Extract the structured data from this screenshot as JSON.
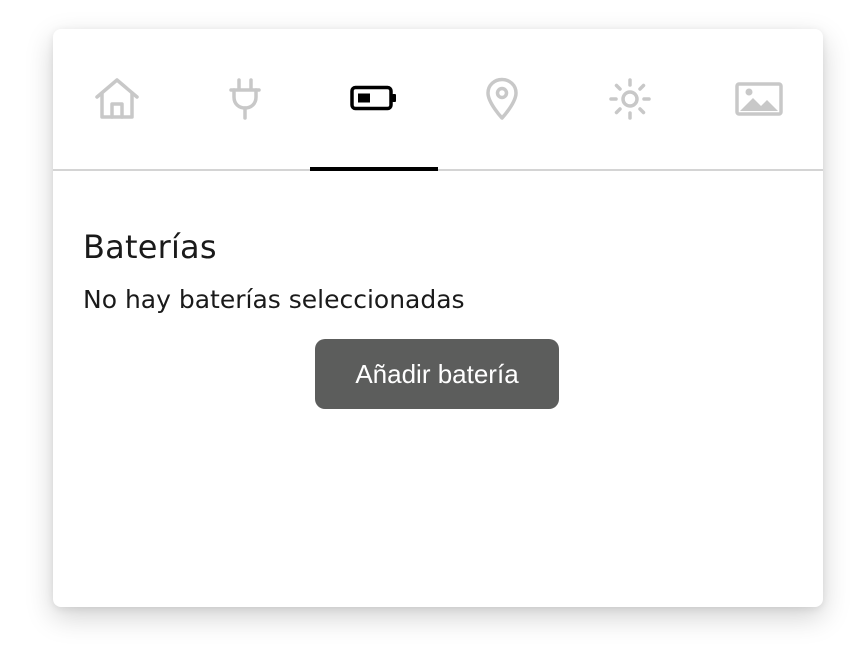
{
  "tabs": [
    {
      "icon": "home-icon",
      "active": false
    },
    {
      "icon": "plug-icon",
      "active": false
    },
    {
      "icon": "battery-icon",
      "active": true
    },
    {
      "icon": "location-pin-icon",
      "active": false
    },
    {
      "icon": "sun-icon",
      "active": false
    },
    {
      "icon": "image-icon",
      "active": false
    }
  ],
  "colors": {
    "inactive_icon": "#c8c8c8",
    "active_icon": "#000000",
    "button_bg": "#5c5d5c"
  },
  "batteries": {
    "title": "Baterías",
    "empty_message": "No hay baterías seleccionadas",
    "add_button_label": "Añadir batería"
  }
}
